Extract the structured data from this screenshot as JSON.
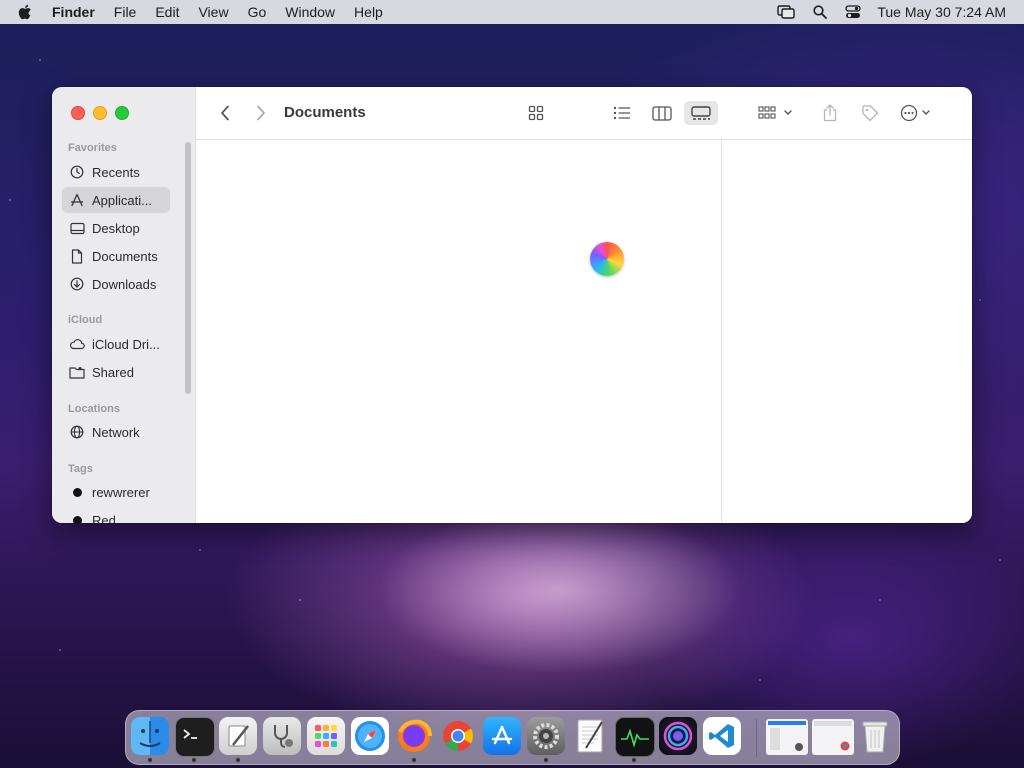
{
  "menubar": {
    "app_name": "Finder",
    "menus": [
      "File",
      "Edit",
      "View",
      "Go",
      "Window",
      "Help"
    ],
    "clock": "Tue May 30  7:24 AM"
  },
  "window": {
    "title": "Documents",
    "sidebar": {
      "sections": {
        "favorites": "Favorites",
        "icloud": "iCloud",
        "locations": "Locations",
        "tags": "Tags"
      },
      "favorites": [
        {
          "label": "Recents",
          "icon": "clock-icon"
        },
        {
          "label": "Applicati...",
          "icon": "apps-icon",
          "selected": true
        },
        {
          "label": "Desktop",
          "icon": "desktop-icon"
        },
        {
          "label": "Documents",
          "icon": "document-icon"
        },
        {
          "label": "Downloads",
          "icon": "download-icon"
        }
      ],
      "icloud": [
        {
          "label": "iCloud Dri...",
          "icon": "cloud-icon"
        },
        {
          "label": "Shared",
          "icon": "shared-folder-icon"
        }
      ],
      "locations": [
        {
          "label": "Network",
          "icon": "globe-icon"
        }
      ],
      "tags": [
        {
          "label": "rewwrerer",
          "color": "#111111"
        },
        {
          "label": "Red",
          "color": "#111111"
        }
      ]
    }
  },
  "dock": {
    "apps": [
      "Finder",
      "Terminal",
      "Script Editor",
      "Disk Utility",
      "Launchpad",
      "Safari",
      "Firefox",
      "Chrome",
      "App Store",
      "System Preferences",
      "TextEdit",
      "Activity Monitor",
      "Siri",
      "VS Code"
    ],
    "running": [
      "Finder",
      "Terminal",
      "Script Editor",
      "Firefox",
      "System Preferences",
      "Activity Monitor"
    ]
  },
  "colors": {
    "accent": "#0a84ff",
    "close": "#fe5f57",
    "minimize": "#febc2e",
    "maximize": "#28c840"
  }
}
